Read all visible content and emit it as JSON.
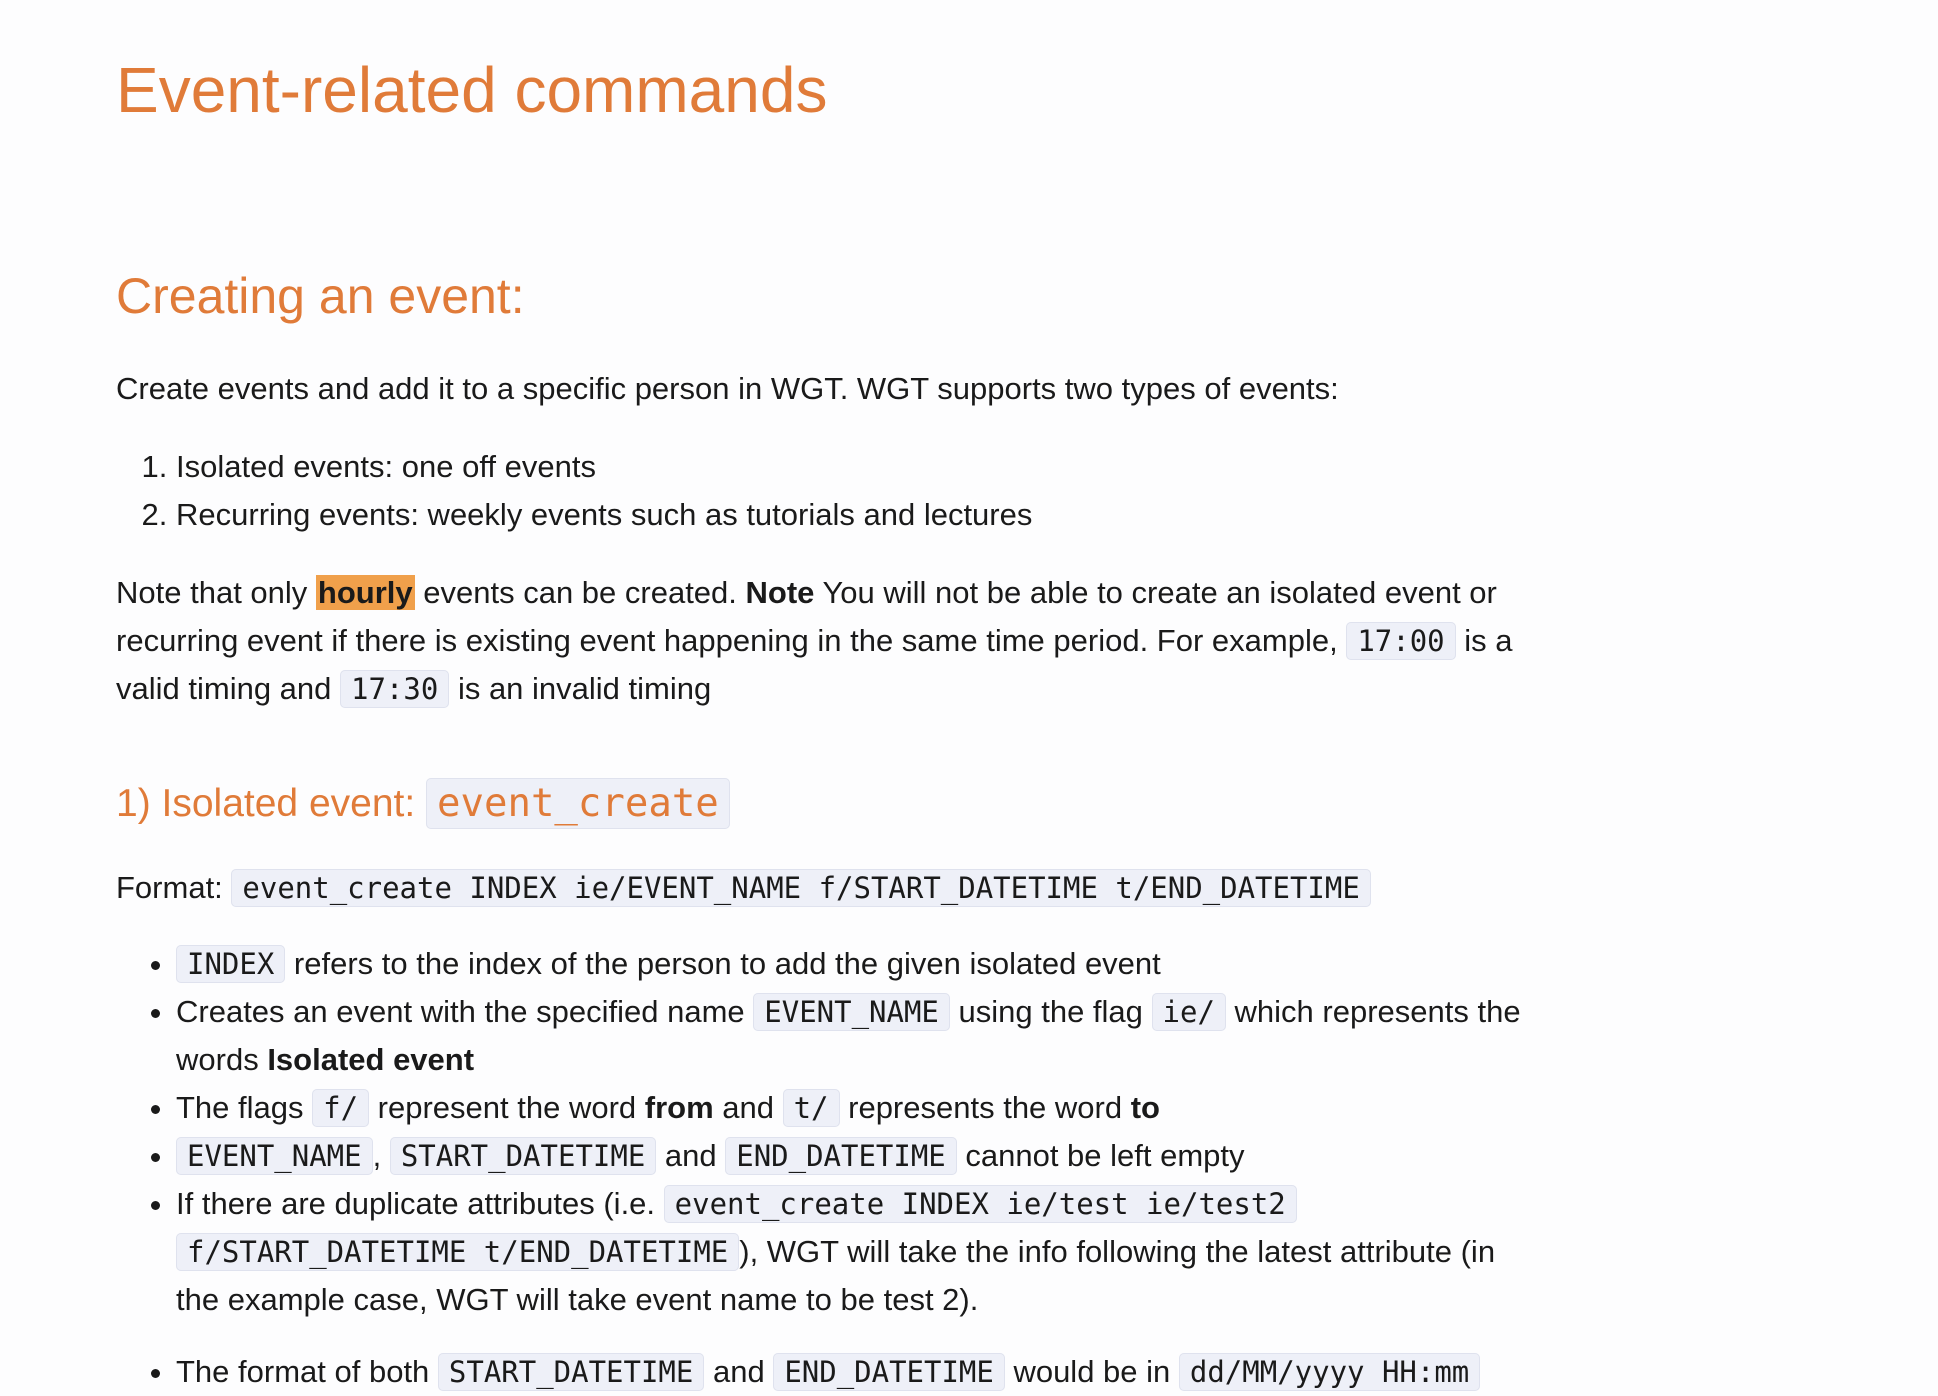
{
  "title": "Event-related commands",
  "section": {
    "heading": "Creating an event:",
    "intro": "Create events and add it to a specific person in WGT. WGT supports two types of events:",
    "types": [
      "Isolated events: one off events",
      "Recurring events: weekly events such as tutorials and lectures"
    ],
    "note": {
      "t1": "Note that only ",
      "highlight": "hourly",
      "t2": " events can be created. ",
      "bold": "Note",
      "t3": " You will not be able to create an isolated event or",
      "t4": "recurring event if there is existing event happening in the same time period. For example, ",
      "code_valid": "17:00",
      "t5": " is a",
      "t6": "valid timing and ",
      "code_invalid": "17:30",
      "t7": " is an invalid timing"
    }
  },
  "subsection": {
    "heading_prefix": "1) Isolated event: ",
    "heading_code": "event_create",
    "format_label": "Format: ",
    "format_code": "event_create INDEX ie/EVENT_NAME f/START_DATETIME t/END_DATETIME",
    "rules": {
      "r1": {
        "code": "INDEX",
        "text": " refers to the index of the person to add the given isolated event"
      },
      "r2": {
        "t1": "Creates an event with the specified name ",
        "code1": "EVENT_NAME",
        "t2": " using the flag ",
        "code2": "ie/",
        "t3": " which represents the",
        "t4": "words ",
        "bold": "Isolated event"
      },
      "r3": {
        "t1": "The flags ",
        "code1": "f/",
        "t2": " represent the word ",
        "bold1": "from",
        "t3": " and ",
        "code2": "t/",
        "t4": " represents the word ",
        "bold2": "to"
      },
      "r4": {
        "code1": "EVENT_NAME",
        "t1": ", ",
        "code2": "START_DATETIME",
        "t2": " and ",
        "code3": "END_DATETIME",
        "t3": " cannot be left empty"
      },
      "r5": {
        "t1": "If there are duplicate attributes (i.e. ",
        "code1": "event_create INDEX ie/test ie/test2",
        "code2": "f/START_DATETIME t/END_DATETIME",
        "t2": "), WGT will take the info following the latest attribute (in",
        "t3": "the example case, WGT will take event name to be test 2)."
      },
      "r6": {
        "t1": "The format of both ",
        "code1": "START_DATETIME",
        "t2": " and ",
        "code2": "END_DATETIME",
        "t3": " would be in ",
        "code3": "dd/MM/yyyy HH:mm"
      }
    }
  }
}
